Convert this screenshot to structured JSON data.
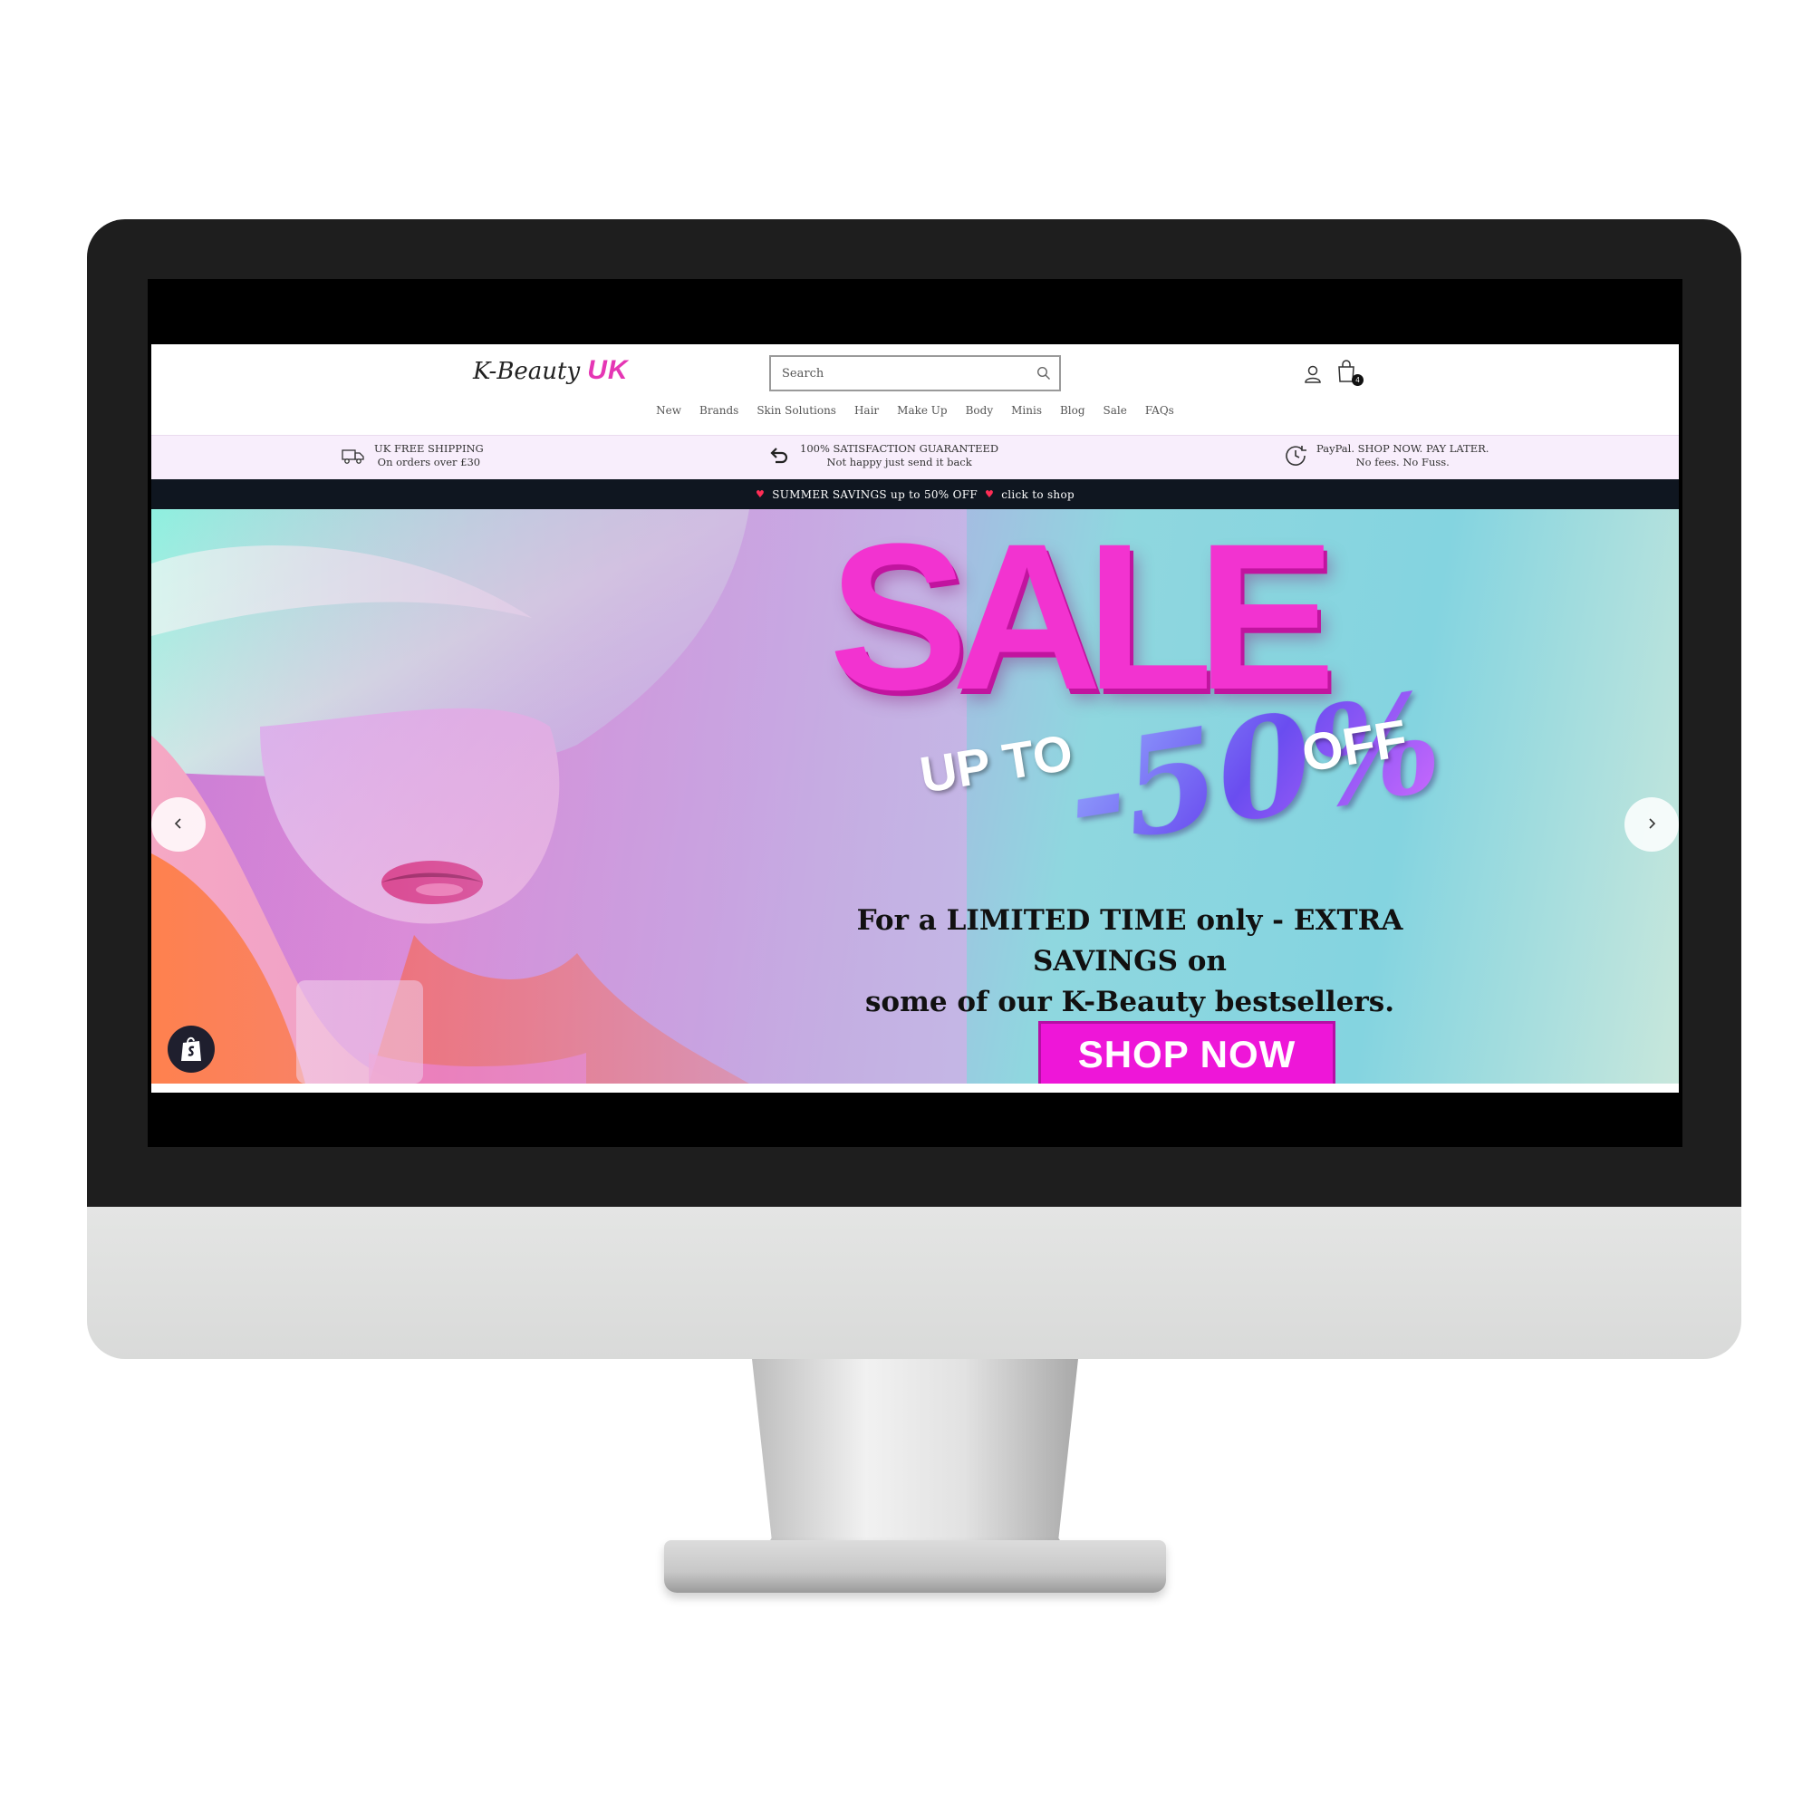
{
  "site": {
    "logo": {
      "script": "K-Beauty",
      "accent": "UK"
    },
    "search": {
      "placeholder": "Search"
    },
    "cart": {
      "count": "4"
    },
    "nav": [
      "New",
      "Brands",
      "Skin Solutions",
      "Hair",
      "Make Up",
      "Body",
      "Minis",
      "Blog",
      "Sale",
      "FAQs"
    ]
  },
  "usp": [
    {
      "icon": "delivery-truck-icon",
      "line1": "UK FREE SHIPPING",
      "line2": "On orders over £30"
    },
    {
      "icon": "return-arrow-icon",
      "line1": "100% SATISFACTION GUARANTEED",
      "line2": "Not happy just send it back"
    },
    {
      "icon": "clock-icon",
      "line1": "PayPal. SHOP NOW. PAY LATER.",
      "line2": "No fees. No Fuss."
    }
  ],
  "announcement": {
    "heart": "♥",
    "text": "SUMMER SAVINGS up to 50% OFF",
    "cta": "click to shop"
  },
  "hero": {
    "headline": "SALE",
    "up_to": "UP TO",
    "percent": "-50%",
    "off": "OFF",
    "promo_line1": "For a LIMITED TIME only - EXTRA SAVINGS on",
    "promo_line2": "some of our K-Beauty bestsellers.",
    "cta": "SHOP NOW"
  },
  "colors": {
    "brand_pink": "#e536b4",
    "cta_magenta": "#ee16d8",
    "usp_background": "#f8eefc",
    "announcement_background": "#0f1620"
  }
}
